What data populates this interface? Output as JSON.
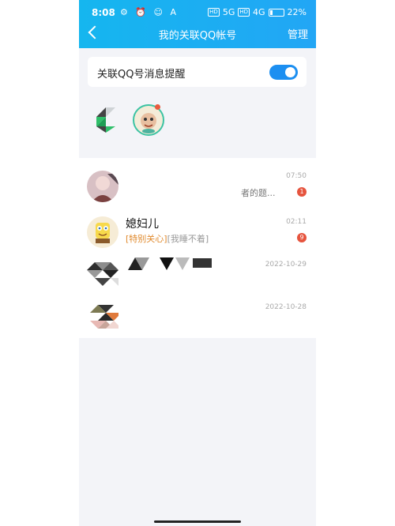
{
  "status_bar": {
    "time": "8:08",
    "left_icons": "⚙ ⏰ ☺ A",
    "net1": "HD",
    "sig1": "5G",
    "net2": "HD",
    "sig2": "4G",
    "battery": "22%"
  },
  "header": {
    "title": "我的关联QQ帐号",
    "manage": "管理"
  },
  "toggle": {
    "label": "关联QQ号消息提醒",
    "on": true
  },
  "accounts": [
    {
      "type": "logo"
    },
    {
      "type": "avatar",
      "has_dot": true
    }
  ],
  "chats": [
    {
      "name": "",
      "preview": "者的题...",
      "time": "07:50",
      "badge": "1"
    },
    {
      "name": "媳妇儿",
      "tag": "[特别关心]",
      "preview": "[我睡不着]",
      "time": "02:11",
      "badge": "9"
    },
    {
      "name": "",
      "preview": "",
      "time": "2022-10-29",
      "badge": ""
    },
    {
      "name": "",
      "preview": "",
      "time": "2022-10-28",
      "badge": ""
    }
  ],
  "colors": {
    "accent": "#1c8ff1",
    "header_start": "#15b6ef",
    "header_end": "#22a6f5",
    "badge": "#e6543e",
    "tag": "#e0892c"
  }
}
